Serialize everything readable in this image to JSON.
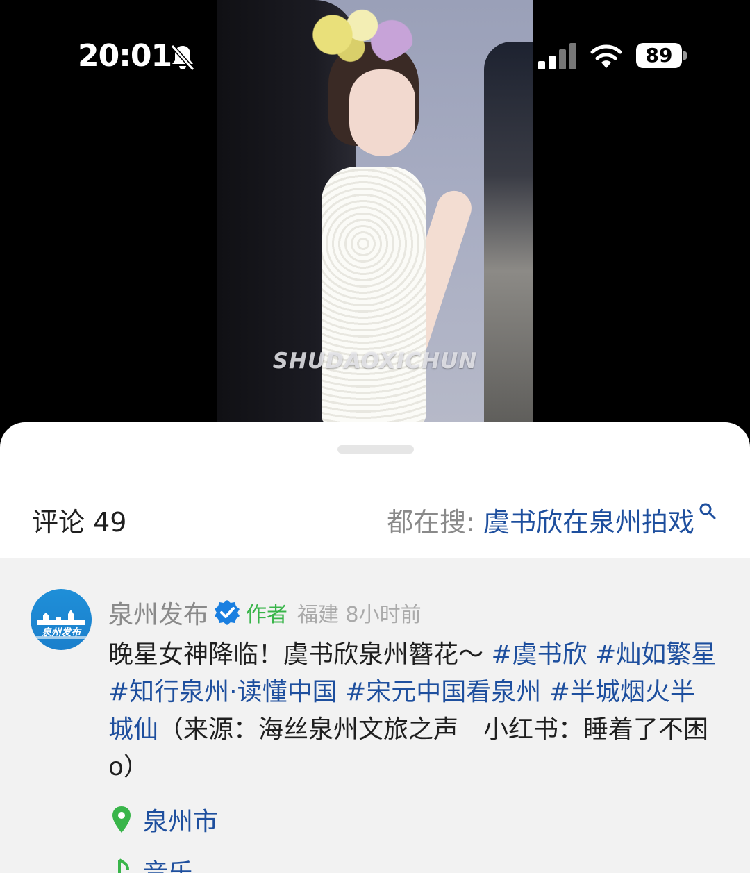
{
  "status_bar": {
    "time": "20:01",
    "battery": "89",
    "icons": [
      "bell-slash-icon",
      "signal-icon",
      "wifi-icon",
      "battery-icon"
    ]
  },
  "media": {
    "watermark": "SHUDAOXICHUN"
  },
  "comments": {
    "title": "评论 49",
    "search_prefix": "都在搜: ",
    "search_term": "虞书欣在泉州拍戏"
  },
  "post": {
    "account_name": "泉州发布",
    "avatar_logo_text": "泉州发布",
    "author_badge": "作者",
    "location_time": "福建 8小时前",
    "text_parts": [
      {
        "t": "晚星女神降临！虞书欣泉州簪花～ ",
        "tag": false
      },
      {
        "t": "#虞书欣",
        "tag": true
      },
      {
        "t": " ",
        "tag": false
      },
      {
        "t": "#灿如繁星",
        "tag": true
      },
      {
        "t": " ",
        "tag": false
      },
      {
        "t": "#知行泉州·读懂中国",
        "tag": true
      },
      {
        "t": " ",
        "tag": false
      },
      {
        "t": "#宋元中国看泉州",
        "tag": true
      },
      {
        "t": " ",
        "tag": false
      },
      {
        "t": "#半城烟火半城仙",
        "tag": true
      },
      {
        "t": "（来源：海丝泉州文旅之声　小红书：睡着了不困o）",
        "tag": false
      }
    ],
    "place": "泉州市",
    "music": "音乐"
  },
  "colors": {
    "link_blue": "#1e4f9e",
    "author_green": "#39b54a",
    "verified_blue": "#1a7fe0"
  }
}
